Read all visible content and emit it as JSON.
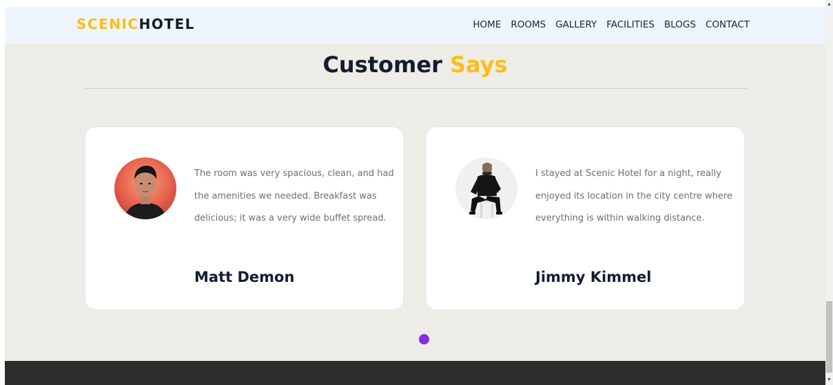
{
  "header": {
    "brand_part1": "SCENIC",
    "brand_part2": "HOTEL",
    "nav": [
      "HOME",
      "ROOMS",
      "GALLERY",
      "FACILITIES",
      "BLOGS",
      "CONTACT"
    ]
  },
  "section": {
    "title_part1": "Customer",
    "title_part2": "Says"
  },
  "testimonials": [
    {
      "quote": "The room was very spacious, clean, and had the amenities we needed. Breakfast was delicious; it was a very wide buffet spread.",
      "name": "Matt Demon"
    },
    {
      "quote": "I stayed at Scenic Hotel for a night, really enjoyed its location in the city centre where everything is within walking distance.",
      "name": "Jimmy Kimmel"
    }
  ],
  "colors": {
    "accent": "#fbbd1c",
    "dark": "#141c30",
    "nav_bg": "#eef5fd",
    "section_bg": "#eeece6",
    "dot_active": "#8a2be2",
    "footer_bg": "#2c2c2c"
  }
}
